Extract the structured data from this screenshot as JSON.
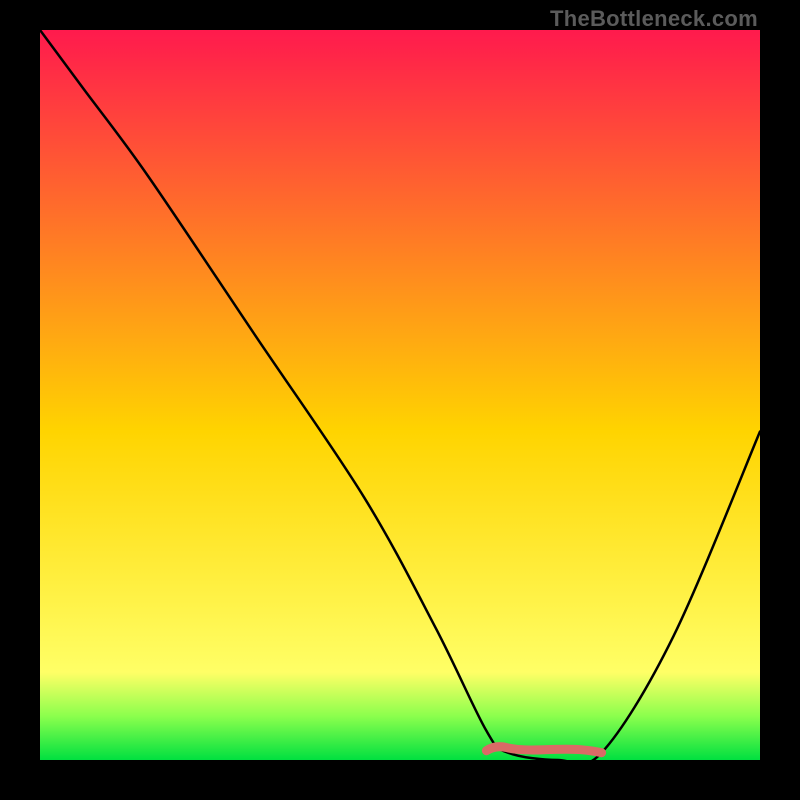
{
  "attribution": "TheBottleneck.com",
  "colors": {
    "top": "#ff1a4d",
    "mid": "#ffd400",
    "low": "#ffff66",
    "green": "#00e040",
    "black": "#000000",
    "curve": "#000000",
    "flat_marker": "#d96b66"
  },
  "chart_data": {
    "type": "line",
    "title": "",
    "xlabel": "",
    "ylabel": "",
    "xlim": [
      0,
      100
    ],
    "ylim": [
      0,
      100
    ],
    "series": [
      {
        "name": "bottleneck-curve",
        "x": [
          0,
          6,
          15,
          30,
          45,
          55,
          62,
          65,
          72,
          78,
          88,
          100
        ],
        "y": [
          100,
          92,
          80,
          58,
          36,
          18,
          4,
          1,
          0,
          1,
          17,
          45
        ]
      }
    ],
    "annotations": [
      {
        "name": "optimal-flat-region",
        "x_start": 62,
        "x_end": 78,
        "y": 1
      }
    ]
  }
}
